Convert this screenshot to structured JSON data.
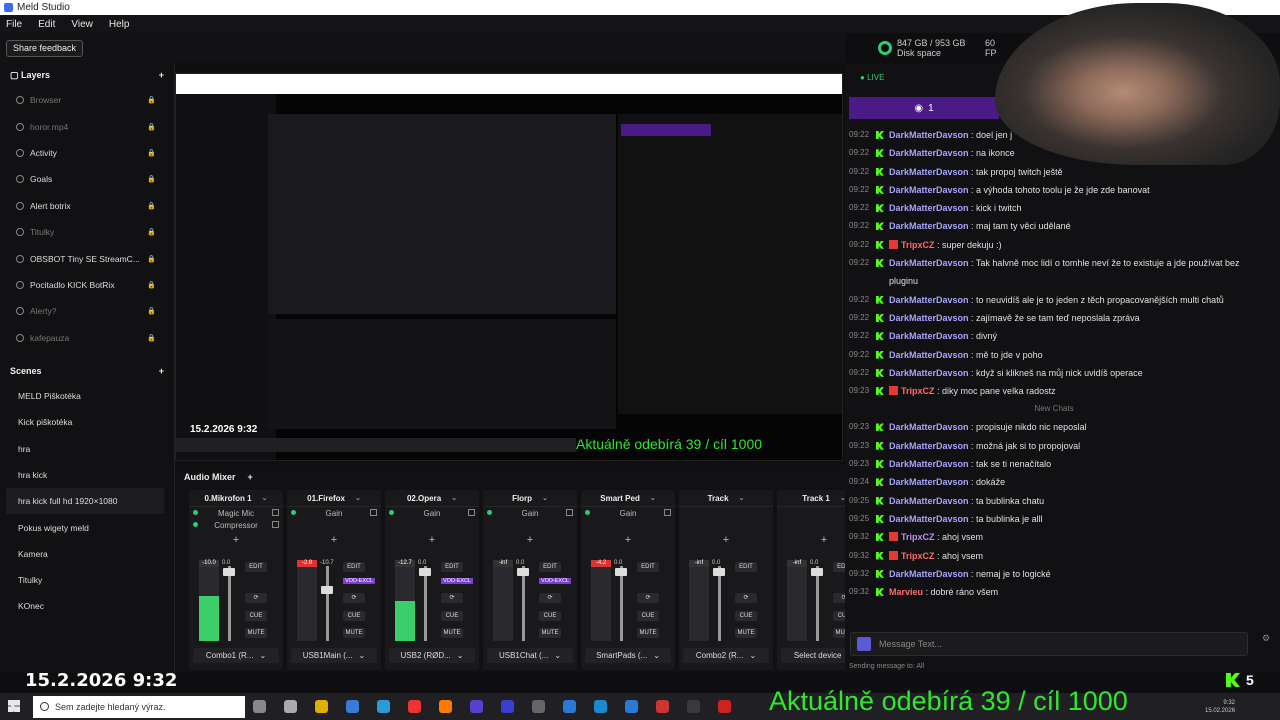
{
  "window": {
    "title": "Meld Studio"
  },
  "menu": [
    "File",
    "Edit",
    "View",
    "Help"
  ],
  "toolbar": {
    "share_feedback": "Share feedback"
  },
  "status": {
    "disk_value": "847 GB / 953 GB",
    "disk_label": "Disk space",
    "fps_value": "60",
    "fps_label": "FP"
  },
  "layers": {
    "title": "Layers",
    "items": [
      {
        "label": "Browser",
        "dim": true
      },
      {
        "label": "horor.mp4",
        "dim": true
      },
      {
        "label": "Activity",
        "dim": false
      },
      {
        "label": "Goals",
        "dim": false
      },
      {
        "label": "Alert botrix",
        "dim": false
      },
      {
        "label": "Titulky",
        "dim": true
      },
      {
        "label": "OBSBOT Tiny SE StreamC...",
        "dim": false
      },
      {
        "label": "Pocitadlo KICK BotRix",
        "dim": false
      },
      {
        "label": "Alerty?",
        "dim": true
      },
      {
        "label": "kafepauza",
        "dim": true
      }
    ]
  },
  "scenes": {
    "title": "Scenes",
    "items": [
      "MELD Piškotéka",
      "Kick piškotéka",
      "hra",
      "hra kick",
      "hra kick full hd 1920×1080",
      "Pokus wigety meld",
      "Kamera",
      "Titulky",
      "KOnec"
    ],
    "selected_index": 4
  },
  "mixer": {
    "title": "Audio Mixer",
    "channels": [
      {
        "name": "0.Mikrofon 1",
        "fx": [
          "Magic Mic",
          "Compressor"
        ],
        "level": 0.55,
        "peak": "-10.0",
        "fader": "0.0",
        "device": "Combo1 (R...",
        "vod": false
      },
      {
        "name": "01.Firefox",
        "fx": [
          "Gain"
        ],
        "level": 0,
        "peak": "-2.8",
        "fader": "-10.7",
        "device": "USB1Main (...",
        "vod": true
      },
      {
        "name": "02.Opera",
        "fx": [
          "Gain"
        ],
        "level": 0.5,
        "peak": "-12.7",
        "fader": "0.0",
        "device": "USB2 (RØD...",
        "vod": true
      },
      {
        "name": "Florp",
        "fx": [
          "Gain"
        ],
        "level": 0,
        "peak": "-inf",
        "fader": "0.0",
        "device": "USB1Chat (...",
        "vod": true
      },
      {
        "name": "Smart Ped",
        "fx": [
          "Gain"
        ],
        "level": 0,
        "peak": "-4.2",
        "fader": "0.0",
        "device": "SmartPads (...",
        "vod": false
      },
      {
        "name": "Track",
        "fx": [],
        "level": 0,
        "peak": "-inf",
        "fader": "0.0",
        "device": "Combo2 (R...",
        "vod": false
      },
      {
        "name": "Track 1",
        "fx": [],
        "level": 0,
        "peak": "-inf",
        "fader": "0.0",
        "device": "Select device",
        "vod": false
      }
    ],
    "buttons": {
      "edit": "EDIT",
      "cue": "CUE",
      "mute": "MUTE",
      "vod": "VOD-EXCL"
    }
  },
  "chat": {
    "live": "LIVE",
    "viewers": "1",
    "new_chats": "New Chats",
    "input_placeholder": "Message Text...",
    "sending": "Sending message to: All",
    "messages": [
      {
        "time": "09:22",
        "user": "DarkMatterDavson",
        "text": "doel jen j",
        "badge": false,
        "cls": ""
      },
      {
        "time": "09:22",
        "user": "DarkMatterDavson",
        "text": "na ikonce",
        "badge": false,
        "cls": ""
      },
      {
        "time": "09:22",
        "user": "DarkMatterDavson",
        "text": "tak propoj twitch ještě",
        "badge": false,
        "cls": ""
      },
      {
        "time": "09:22",
        "user": "DarkMatterDavson",
        "text": "a výhoda tohoto toolu je že jde zde banovat",
        "badge": false,
        "cls": ""
      },
      {
        "time": "09:22",
        "user": "DarkMatterDavson",
        "text": "kick i twitch",
        "badge": false,
        "cls": ""
      },
      {
        "time": "09:22",
        "user": "DarkMatterDavson",
        "text": "maj tam ty věci udělané",
        "badge": false,
        "cls": ""
      },
      {
        "time": "09:22",
        "user": "TripxCZ",
        "text": "super dekuju :)",
        "badge": true,
        "cls": "red"
      },
      {
        "time": "09:22",
        "user": "DarkMatterDavson",
        "text": "Tak halvně moc lidí o tomhle neví že to existuje a jde používat bez pluginu",
        "badge": false,
        "cls": ""
      },
      {
        "time": "09:22",
        "user": "DarkMatterDavson",
        "text": "to neuvidíš ale je to jeden z těch propacovanějších multi chatů",
        "badge": false,
        "cls": ""
      },
      {
        "time": "09:22",
        "user": "DarkMatterDavson",
        "text": "zajímavě že se tam teď neposlala zpráva",
        "badge": false,
        "cls": ""
      },
      {
        "time": "09:22",
        "user": "DarkMatterDavson",
        "text": "divný",
        "badge": false,
        "cls": ""
      },
      {
        "time": "09:22",
        "user": "DarkMatterDavson",
        "text": "mě to jde v poho",
        "badge": false,
        "cls": ""
      },
      {
        "time": "09:22",
        "user": "DarkMatterDavson",
        "text": "když si klikneš na můj nick uvidíš operace",
        "badge": false,
        "cls": ""
      },
      {
        "time": "09:23",
        "user": "TripxCZ",
        "text": "diky moc pane velka radostz",
        "badge": true,
        "cls": "red"
      }
    ],
    "messages2": [
      {
        "time": "09:23",
        "user": "DarkMatterDavson",
        "text": "propisuje nikdo nic neposlal",
        "badge": false,
        "cls": ""
      },
      {
        "time": "09:23",
        "user": "DarkMatterDavson",
        "text": "možná jak si to propojoval",
        "badge": false,
        "cls": ""
      },
      {
        "time": "09:23",
        "user": "DarkMatterDavson",
        "text": "tak se ti nenačítalo",
        "badge": false,
        "cls": ""
      },
      {
        "time": "09:24",
        "user": "DarkMatterDavson",
        "text": "dokáže",
        "badge": false,
        "cls": ""
      },
      {
        "time": "09:25",
        "user": "DarkMatterDavson",
        "text": "ta bublinka chatu",
        "badge": false,
        "cls": ""
      },
      {
        "time": "09:25",
        "user": "DarkMatterDavson",
        "text": "ta bublinka je alll",
        "badge": false,
        "cls": ""
      },
      {
        "time": "09:32",
        "user": "TripxCZ",
        "text": "ahoj vsem",
        "badge": true,
        "cls": "tx"
      },
      {
        "time": "09:32",
        "user": "TripxCZ",
        "text": "ahoj vsem",
        "badge": true,
        "cls": "red"
      },
      {
        "time": "09:32",
        "user": "DarkMatterDavson",
        "text": "nemaj je to logické",
        "badge": false,
        "cls": ""
      },
      {
        "time": "09:32",
        "user": "Marvieu",
        "text": "dobré ráno všem",
        "badge": false,
        "cls": "red"
      }
    ]
  },
  "overlay": {
    "datetime": "15.2.2026 9:32",
    "goal": "Aktuálně odebírá 39 / cíl 1000",
    "kick_count": "5"
  },
  "taskbar": {
    "search_placeholder": "Sem zadejte hledaný výraz.",
    "clock_time": "9:32",
    "clock_date": "15.02.2026"
  },
  "colors": {
    "accent": "#53fc18",
    "live": "#2ecc71",
    "purple": "#4a1a86"
  }
}
